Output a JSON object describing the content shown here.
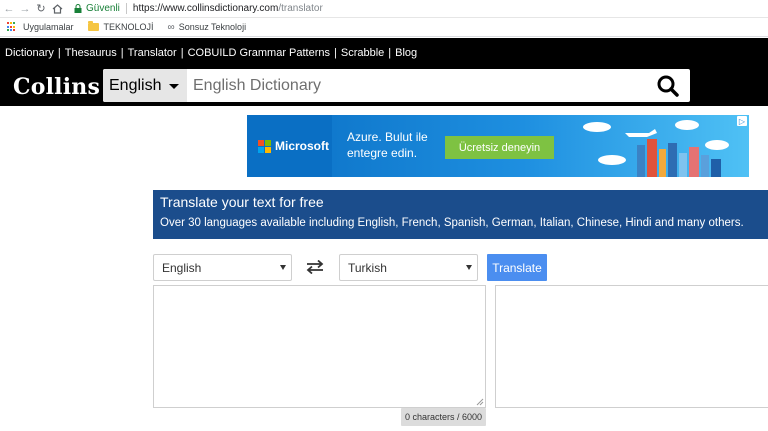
{
  "browser": {
    "secure_label": "Güvenli",
    "url_host": "https://www.collinsdictionary.com",
    "url_path": "/translator",
    "bookmarks": [
      "Uygulamalar",
      "TEKNOLOJİ",
      "Sonsuz Teknoloji"
    ]
  },
  "topnav": {
    "items": [
      "Dictionary",
      "Thesaurus",
      "Translator",
      "COBUILD Grammar Patterns",
      "Scrabble",
      "Blog"
    ],
    "separator": "|"
  },
  "header": {
    "logo": "Collins",
    "language": "English",
    "search_placeholder": "English Dictionary"
  },
  "ad": {
    "brand": "Microsoft",
    "line1": "Azure. Bulut ile",
    "line2": "entegre edin.",
    "cta": "Ücretsiz deneyin",
    "info": "▷"
  },
  "banner": {
    "title": "Translate your text for free",
    "subtitle": "Over 30 languages available including English, French, Spanish, German, Italian, Chinese, Hindi and many others."
  },
  "translator": {
    "source_language": "English",
    "target_language": "Turkish",
    "button_label": "Translate",
    "source_text": "",
    "counter": "0 characters / 6000"
  },
  "colors": {
    "header_bg": "#000000",
    "banner_bg": "#1b4d8c",
    "button_bg": "#4b8ef0",
    "ad_cta": "#7ec242"
  }
}
